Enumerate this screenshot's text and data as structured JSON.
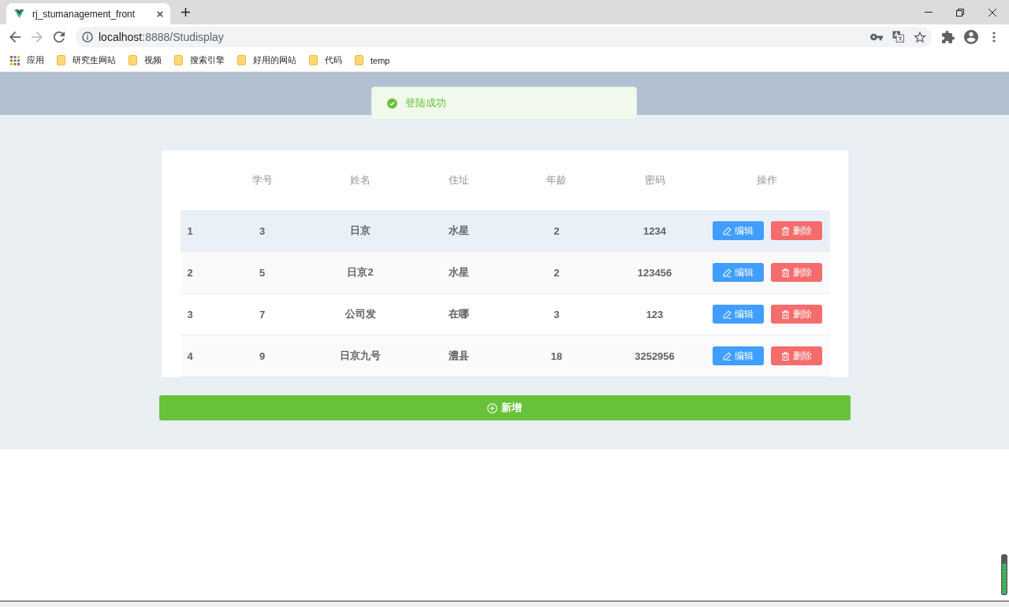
{
  "browser": {
    "tab": {
      "title": "rj_stumanagement_front",
      "selected": true
    },
    "nav": [
      {
        "kind": "back",
        "disabled": false
      },
      {
        "kind": "forward",
        "disabled": true
      },
      {
        "kind": "reload",
        "disabled": false
      }
    ],
    "url": {
      "host": "localhost",
      "path": ":8888/Studisplay"
    },
    "bookmarks": [
      {
        "kind": "apps",
        "label": "应用"
      },
      {
        "kind": "folder",
        "label": "研究生网站"
      },
      {
        "kind": "folder",
        "label": "视频"
      },
      {
        "kind": "folder",
        "label": "搜索引擎"
      },
      {
        "kind": "folder",
        "label": "好用的网站"
      },
      {
        "kind": "folder",
        "label": "代码"
      },
      {
        "kind": "folder",
        "label": "temp"
      }
    ]
  },
  "toast": {
    "kind": "success",
    "message": "登陆成功"
  },
  "table": {
    "columns": [
      "学号",
      "姓名",
      "住址",
      "年龄",
      "密码",
      "操作"
    ],
    "rows": [
      {
        "number": "1",
        "values": [
          "3",
          "日京",
          "水星",
          "2",
          "1234"
        ],
        "selected": true,
        "actions": [
          {
            "kind": "edit",
            "label": "编辑"
          },
          {
            "kind": "delete",
            "label": "删除"
          }
        ]
      },
      {
        "number": "2",
        "values": [
          "5",
          "日京2",
          "水星",
          "2",
          "123456"
        ],
        "selected": false,
        "actions": [
          {
            "kind": "edit",
            "label": "编辑"
          },
          {
            "kind": "delete",
            "label": "删除"
          }
        ]
      },
      {
        "number": "3",
        "values": [
          "7",
          "公司发",
          "在哪",
          "3",
          "123"
        ],
        "selected": false,
        "actions": [
          {
            "kind": "edit",
            "label": "编辑"
          },
          {
            "kind": "delete",
            "label": "删除"
          }
        ]
      },
      {
        "number": "4",
        "values": [
          "9",
          "日京九号",
          "澧县",
          "18",
          "3252956"
        ],
        "selected": false,
        "actions": [
          {
            "kind": "edit",
            "label": "编辑"
          },
          {
            "kind": "delete",
            "label": "删除"
          }
        ]
      }
    ]
  },
  "add_button": {
    "label": "新增"
  }
}
